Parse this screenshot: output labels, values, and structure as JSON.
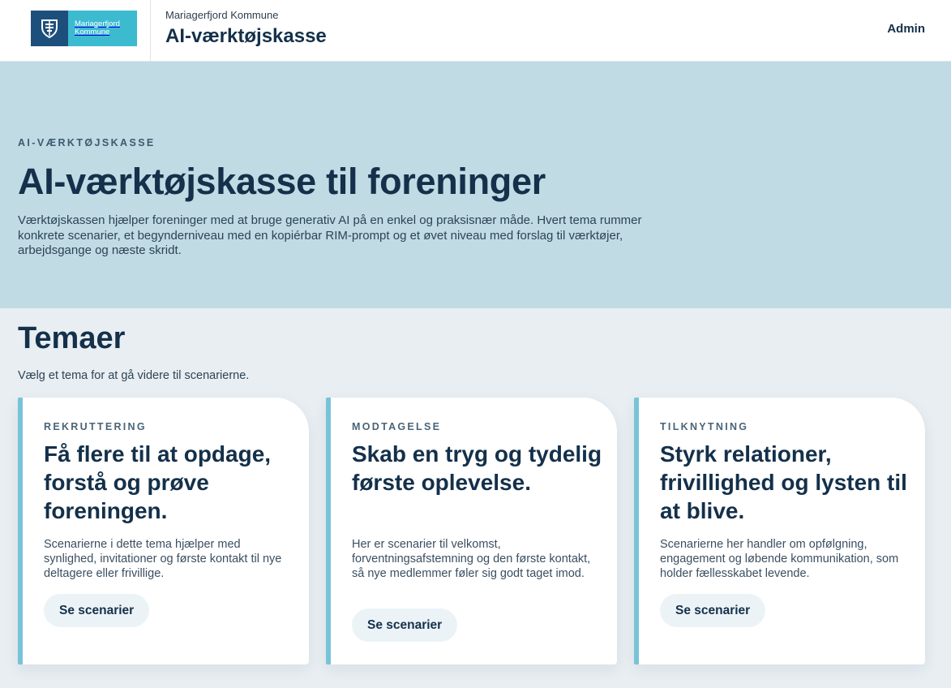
{
  "header": {
    "logo_line1": "Mariagerfjord",
    "logo_line2": "Kommune",
    "org_name": "Mariagerfjord Kommune",
    "app_title": "AI-værktøjskasse",
    "admin_label": "Admin"
  },
  "hero": {
    "eyebrow": "AI-VÆRKTØJSKASSE",
    "title": "AI-værktøjskasse til foreninger",
    "description": "Værktøjskassen hjælper foreninger med at bruge generativ AI på en enkel og praksisnær måde. Hvert tema rummer konkrete scenarier, et begynderniveau med en kopiérbar RIM-prompt og et øvet niveau med forslag til værktøjer, arbejdsgange og næste skridt."
  },
  "themes": {
    "title": "Temaer",
    "subtitle": "Vælg et tema for at gå videre til scenarierne.",
    "cards": [
      {
        "eyebrow": "REKRUTTERING",
        "title": "Få flere til at opdage, forstå og prøve foreningen.",
        "description": "Scenarierne i dette tema hjælper med synlighed, invitationer og første kontakt til nye deltagere eller frivillige.",
        "button_label": "Se scenarier"
      },
      {
        "eyebrow": "MODTAGELSE",
        "title": "Skab en tryg og tydelig første oplevelse.",
        "description": "Her er scenarier til velkomst, forventningsafstemning og den første kontakt, så nye medlemmer føler sig godt taget imod.",
        "button_label": "Se scenarier"
      },
      {
        "eyebrow": "TILKNYTNING",
        "title": "Styrk relationer, frivillighed og lysten til at blive.",
        "description": "Scenarierne her handler om opfølgning, engagement og løbende kommunikation, som holder fællesskabet levende.",
        "button_label": "Se scenarier"
      }
    ]
  },
  "colors": {
    "navy": "#14304a",
    "hero_bg": "#c0dbe4",
    "page_bg": "#e8eef2",
    "card_accent": "#78c3d8",
    "logo_dark": "#1d4f7c",
    "logo_light": "#3cbad0",
    "button_bg": "#ecf3f7"
  }
}
